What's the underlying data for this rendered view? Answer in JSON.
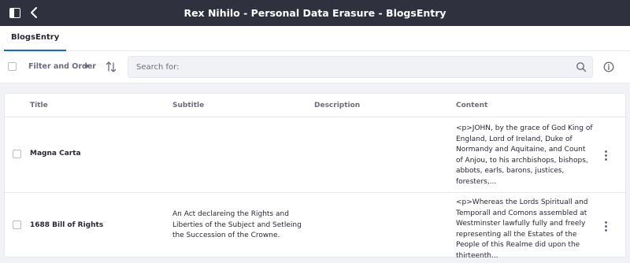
{
  "header": {
    "title": "Rex Nihilo - Personal Data Erasure - BlogsEntry"
  },
  "nav": {
    "tabs": [
      {
        "label": "BlogsEntry"
      }
    ]
  },
  "toolbar": {
    "filter_label": "Filter and Order",
    "search_placeholder": "Search for:"
  },
  "table": {
    "columns": [
      "Title",
      "Subtitle",
      "Description",
      "Content"
    ],
    "rows": [
      {
        "title": "Magna Carta",
        "subtitle": "",
        "description": "",
        "content": "<p>JOHN, by the grace of God King of England, Lord of Ireland, Duke of Normandy and Aquitaine, and Count of Anjou, to his archbishops, bishops, abbots, earls, barons, justices, foresters,..."
      },
      {
        "title": "1688 Bill of Rights",
        "subtitle": "An Act declareing the Rights and Liberties of the Subject and Setleing the Succession of the Crowne.",
        "description": "",
        "content": "<p>Whereas the Lords Spirituall and Temporall and Comons assembled at Westminster lawfully fully and freely representing all the Estates of the People of this Realme did upon the thirteenth..."
      }
    ]
  },
  "colors": {
    "header_bg": "#30313f",
    "accent": "#0b5fff",
    "page_bg": "#f1f2f5"
  },
  "icons": {
    "panel": "product-menu-icon",
    "back": "back-arrow-icon",
    "sort": "sort-icon",
    "search": "search-icon",
    "info": "info-icon",
    "row_actions": "ellipsis-vertical-icon"
  }
}
